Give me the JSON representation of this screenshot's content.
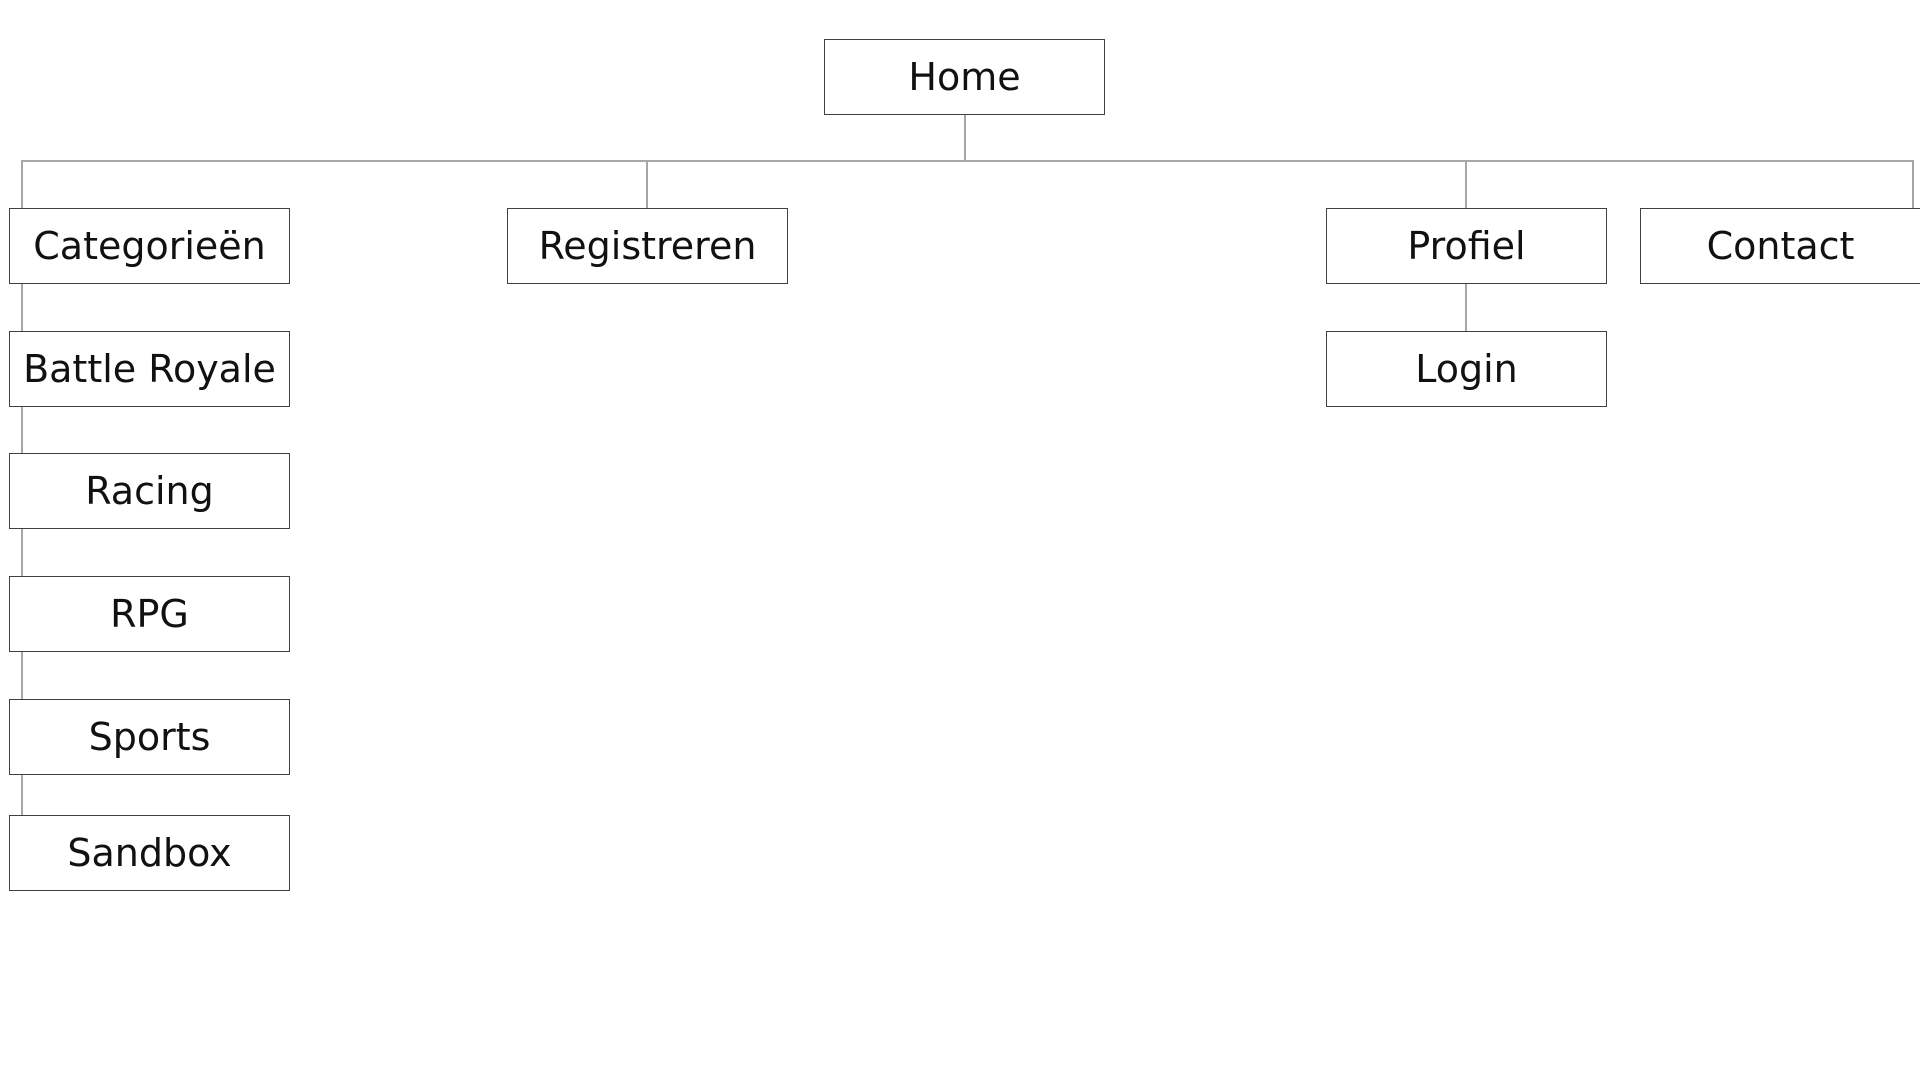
{
  "sitemap": {
    "root": "Home",
    "branches": {
      "categorieen": {
        "label": "Categorieën",
        "children": [
          "Battle Royale",
          "Racing",
          "RPG",
          "Sports",
          "Sandbox"
        ]
      },
      "registreren": {
        "label": "Registreren"
      },
      "profiel": {
        "label": "Profiel",
        "children": [
          "Login"
        ]
      },
      "contact": {
        "label": "Contact"
      }
    }
  },
  "colors": {
    "connector": "#a6a6a6",
    "box_border": "#404040",
    "text": "#111111",
    "background": "#ffffff"
  }
}
